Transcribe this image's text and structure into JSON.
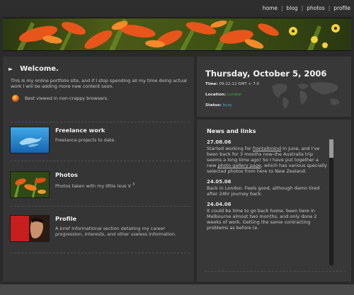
{
  "nav": {
    "items": [
      "home",
      "blog",
      "photos",
      "profile"
    ],
    "separator": "|"
  },
  "welcome": {
    "title": "Welcome.",
    "text": "This is my online portfolio site, and if I stop spending all my time doing actual work I will be adding more new content soon.",
    "best_viewed": "Best viewed in non-crappy browsers."
  },
  "sections": [
    {
      "title": "Freelance work",
      "desc": "Freelance projects to date."
    },
    {
      "title": "Photos",
      "desc": "Photos taken with my little Ixus V",
      "sup": "3"
    },
    {
      "title": "Profile",
      "desc": "A brief informational section detailing my career progression, interests, and other useless information."
    }
  ],
  "info": {
    "date": "Thursday, October 5, 2006",
    "time_label": "Time:",
    "time_value": "09:22:12 GMT + 7:0",
    "location_label": "Location:",
    "location_value": "London",
    "status_label": "Status:",
    "status_value": "busy"
  },
  "news": {
    "title": "News and links",
    "entries": [
      {
        "date": "27.08.06",
        "pre": "Started working for ",
        "link1": "frontaltmind",
        "mid": " in June, and I've been back for 3 months now-the Australia trip seems a long time ago! So I have put together a new ",
        "link2": "photo gallery page",
        "post": ", which has various specially selected photos from here to New Zealand."
      },
      {
        "date": "24.05.06",
        "text": "Back in London. Feels good, although damn tired after 24hr journey back."
      },
      {
        "date": "24.04.06",
        "text": "It could be time to go back home. been here in Melbourne almost two months, and only done 2 weeks of work. Getting the same contracting problems as before (e."
      }
    ]
  },
  "colors": {
    "background": "#2a2a2a",
    "panel": "#353535",
    "location_green": "#36b136",
    "status_blue": "#4ea6d6"
  }
}
